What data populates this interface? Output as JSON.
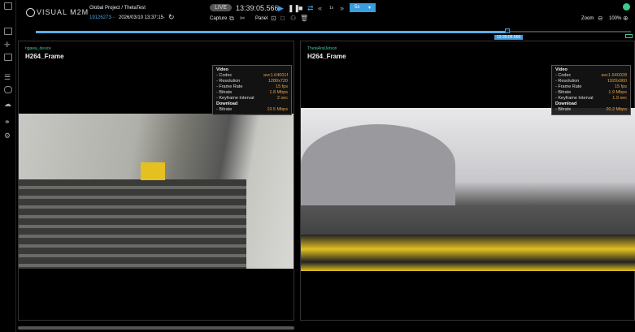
{
  "header": {
    "logo": "VISUAL M2M",
    "project": "Global Project / ThetaTest",
    "session_id": "19126273···",
    "session_time": "2026/03/10 13:37:15·",
    "live": "LIVE",
    "time": "13:39:05.566",
    "speed": "1x",
    "interval": "5s",
    "capture_label": "Capture",
    "panel_label": "Panel",
    "zoom_label": "Zoom",
    "zoom_value": "100%",
    "status_color": "#3fc98f"
  },
  "timeline": {
    "cursor_label": "13:39:05.566",
    "progress": 0.79
  },
  "panels": [
    {
      "device": "ngawa_device",
      "title": "H264_Frame",
      "info": {
        "video_heading": "Video",
        "rows": [
          [
            "- Codec",
            "avc1.64001f"
          ],
          [
            "- Resolution",
            "1280x720"
          ],
          [
            "- Frame Rate",
            "15 fps"
          ],
          [
            "- Bitrate",
            "1.8 Mbps"
          ],
          [
            "- Keyframe Interval",
            "2 sec"
          ]
        ],
        "download_heading": "Download",
        "download": [
          "- Bitrate",
          "19.5 Mbps"
        ]
      }
    },
    {
      "device": "ThetaAndJetson",
      "title": "H264_Frame",
      "info": {
        "video_heading": "Video",
        "rows": [
          [
            "- Codec",
            "avc1.640028"
          ],
          [
            "- Resolution",
            "1920x960"
          ],
          [
            "- Frame Rate",
            "15 fps"
          ],
          [
            "- Bitrate",
            "1.9 Mbps"
          ],
          [
            "- Keyframe Interval",
            "1.9 sec"
          ]
        ],
        "download_heading": "Download",
        "download": [
          "- Bitrate",
          "20.2 Mbps"
        ]
      }
    }
  ]
}
